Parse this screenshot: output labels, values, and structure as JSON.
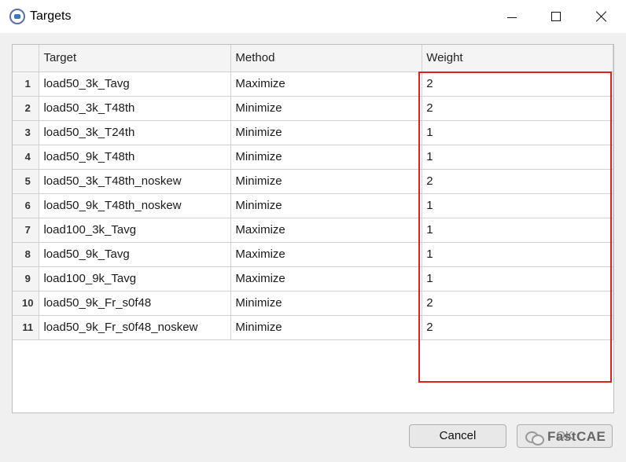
{
  "window": {
    "title": "Targets",
    "icons": [
      "app-icon",
      "minimize-icon",
      "maximize-icon",
      "close-icon"
    ]
  },
  "table": {
    "columns": [
      "Target",
      "Method",
      "Weight"
    ],
    "rows": [
      {
        "num": "1",
        "target": "load50_3k_Tavg",
        "method": "Maximize",
        "weight": "2"
      },
      {
        "num": "2",
        "target": "load50_3k_T48th",
        "method": "Minimize",
        "weight": "2"
      },
      {
        "num": "3",
        "target": "load50_3k_T24th",
        "method": "Minimize",
        "weight": "1"
      },
      {
        "num": "4",
        "target": "load50_9k_T48th",
        "method": "Minimize",
        "weight": "1"
      },
      {
        "num": "5",
        "target": "load50_3k_T48th_noskew",
        "method": "Minimize",
        "weight": "2"
      },
      {
        "num": "6",
        "target": "load50_9k_T48th_noskew",
        "method": "Minimize",
        "weight": "1"
      },
      {
        "num": "7",
        "target": "load100_3k_Tavg",
        "method": "Maximize",
        "weight": "1"
      },
      {
        "num": "8",
        "target": "load50_9k_Tavg",
        "method": "Maximize",
        "weight": "1"
      },
      {
        "num": "9",
        "target": "load100_9k_Tavg",
        "method": "Maximize",
        "weight": "1"
      },
      {
        "num": "10",
        "target": "load50_9k_Fr_s0f48",
        "method": "Minimize",
        "weight": "2"
      },
      {
        "num": "11",
        "target": "load50_9k_Fr_s0f48_noskew",
        "method": "Minimize",
        "weight": "2"
      }
    ]
  },
  "buttons": {
    "cancel": "Cancel",
    "ok": "OK"
  },
  "watermark": {
    "text": "FastCAE",
    "icon": "wechat-icon"
  },
  "colors": {
    "highlight": "#e02020",
    "header_bg": "#f4f4f4",
    "dialog_bg": "#f0f0f0"
  }
}
